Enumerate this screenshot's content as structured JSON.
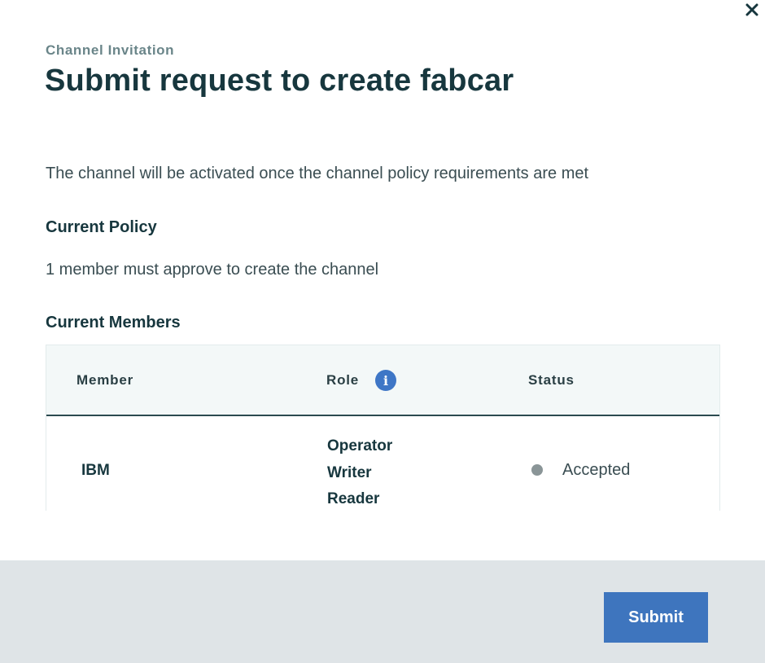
{
  "modal": {
    "eyebrow": "Channel Invitation",
    "title": "Submit request to create fabcar",
    "description": "The channel will be activated once the channel policy requirements are met",
    "close_icon": "close-icon"
  },
  "policy": {
    "heading": "Current Policy",
    "text": "1 member must approve to create the channel"
  },
  "members": {
    "heading": "Current Members",
    "columns": [
      "Member",
      "Role",
      "Status"
    ],
    "role_info_icon": "info-icon",
    "rows": [
      {
        "member": "IBM",
        "roles": [
          "Operator",
          "Writer",
          "Reader"
        ],
        "status": "Accepted"
      }
    ]
  },
  "footer": {
    "submit_label": "Submit"
  },
  "colors": {
    "primary_button": "#3e75be",
    "info_icon": "#3e76c6",
    "footer_bg": "#dfe4e7",
    "status_dot": "#8a9597"
  }
}
